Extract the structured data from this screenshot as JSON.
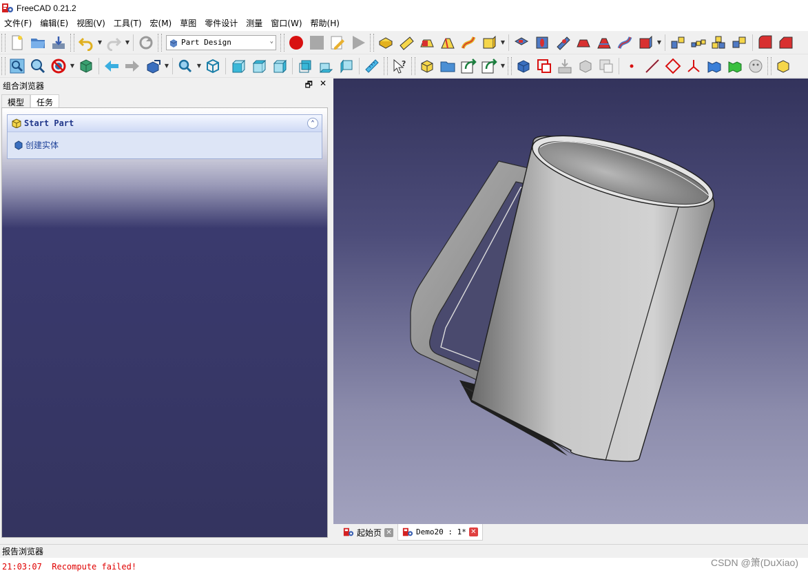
{
  "window": {
    "title": "FreeCAD 0.21.2"
  },
  "menu": [
    "文件(F)",
    "编辑(E)",
    "视图(V)",
    "工具(T)",
    "宏(M)",
    "草图",
    "零件设计",
    "测量",
    "窗口(W)",
    "帮助(H)"
  ],
  "toolbar": {
    "workbench": "Part Design"
  },
  "combo_view": {
    "title": "组合浏览器",
    "tabs": [
      "模型",
      "任务"
    ],
    "active_tab": "任务",
    "task_box_title": "Start Part",
    "task_action": "创建实体"
  },
  "document_tabs": [
    {
      "label": "起始页",
      "active": false
    },
    {
      "label": "Demo20 : 1*",
      "active": true
    }
  ],
  "report": {
    "title": "报告浏览器",
    "message": "21:03:07  Recompute failed!"
  },
  "watermark": "CSDN @箫(DuXiao)",
  "colors": {
    "accent": "#21449a",
    "error": "#e00000",
    "viewport_top": "#33335c",
    "viewport_bottom": "#a2a2be"
  }
}
